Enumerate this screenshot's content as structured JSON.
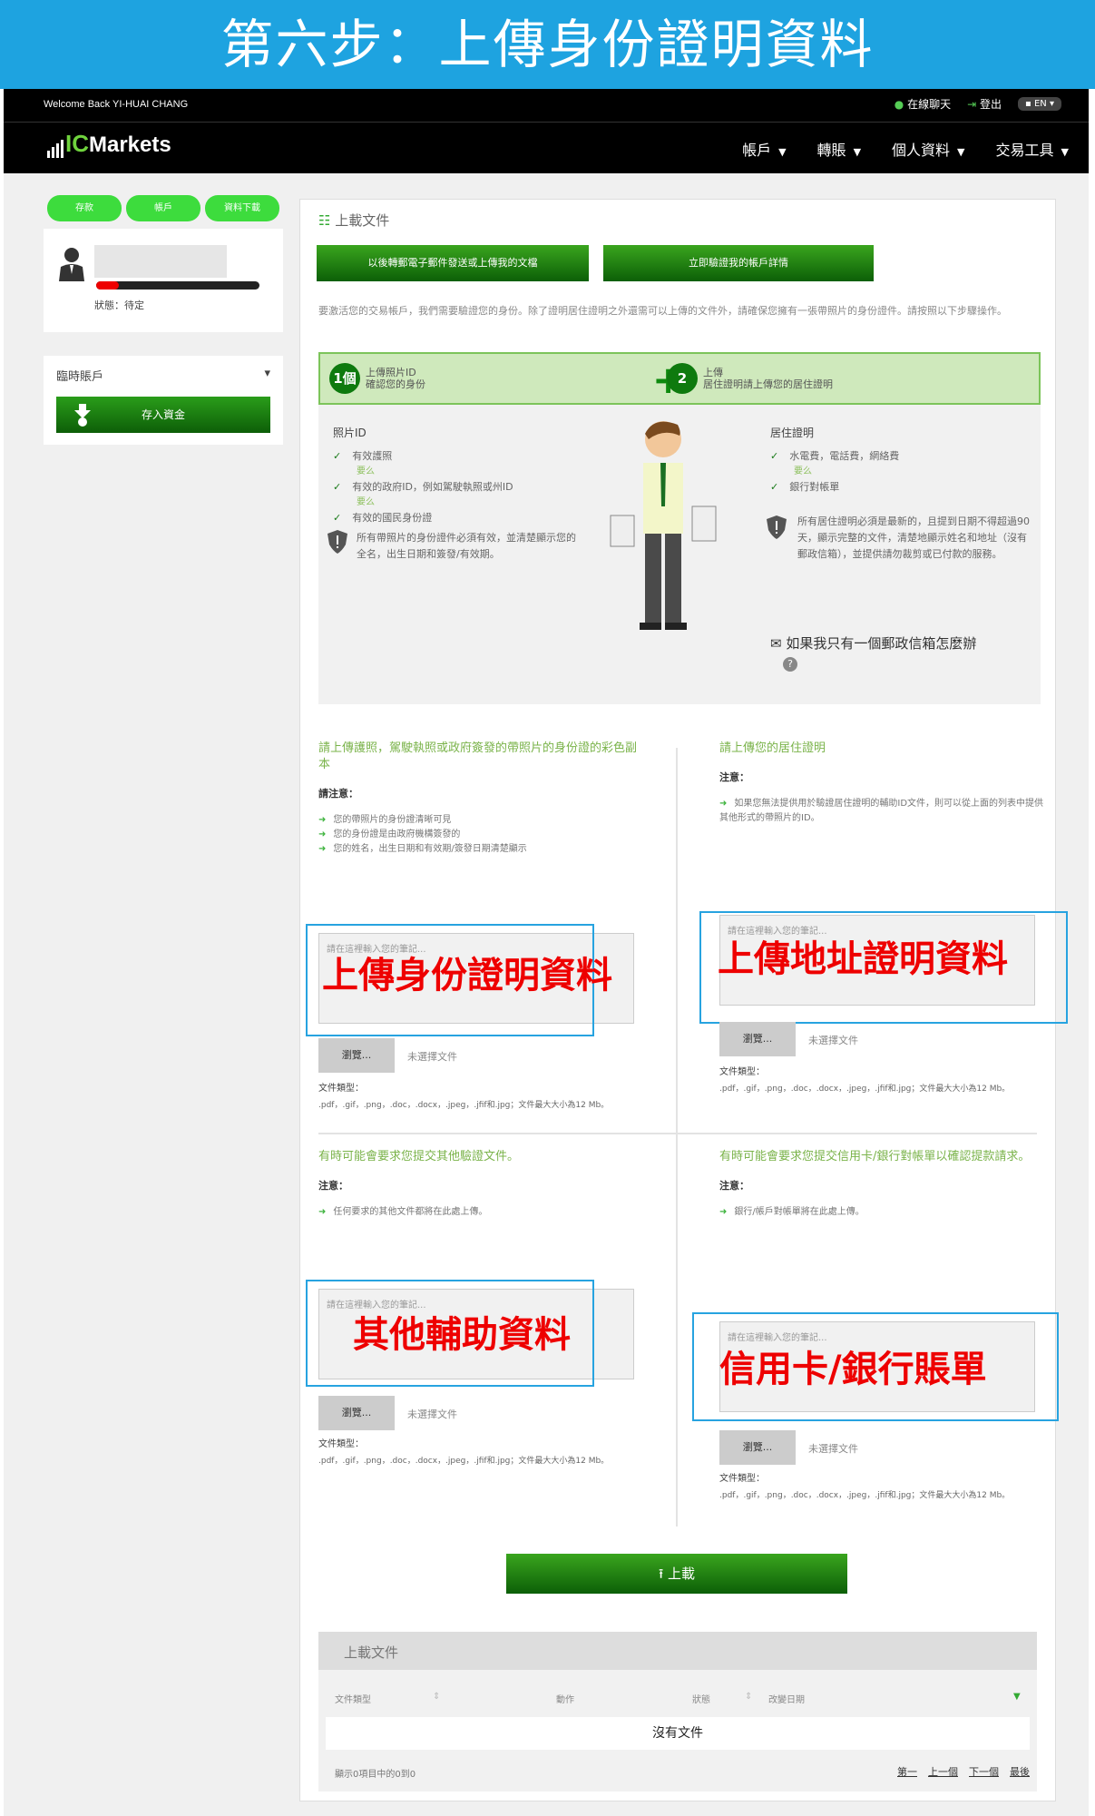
{
  "banner": {
    "title": "第六步：上傳身份證明資料"
  },
  "topbar": {
    "welcome": "Welcome Back YI-HUAI CHANG",
    "chat": "在線聊天",
    "logout": "登出",
    "lang": "EN"
  },
  "nav": {
    "logo": "Markets",
    "logo_ic": "IC",
    "items": [
      "帳戶",
      "轉賬",
      "個人資料",
      "交易工具"
    ]
  },
  "sidebar": {
    "pills": [
      "存款",
      "帳戶",
      "資料下載"
    ],
    "status": "狀態：待定",
    "progress": 0.14,
    "account_label": "臨時賬戶",
    "deposit": "存入資金"
  },
  "main": {
    "title": "上載文件",
    "btn_email": "以後轉郵電子郵件發送或上傳我的文檔",
    "btn_verify": "立即驗證我的帳戶詳情",
    "intro": "要激活您的交易帳戶，我們需要驗證您的身份。除了證明居住證明之外還需可以上傳的文件外，請確保您擁有一張帶照片的身份證件。請按照以下步驟操作。",
    "step1_num": "1個",
    "step1_t1": "上傳照片ID",
    "step1_t2": "確認您的身份",
    "step2_num": "2",
    "step2_t1": "上傳",
    "step2_t2": "居住證明請上傳您的居住證明",
    "left_head": "照片ID",
    "left_items": [
      "有效護照",
      "有效的政府ID，例如駕駛執照或州ID",
      "有效的國民身份證"
    ],
    "or": "要么",
    "left_note": "所有帶照片的身份證件必須有效，並清楚顯示您的全名，出生日期和簽發/有效期。",
    "right_head": "居住證明",
    "right_items": [
      "水電費，電話費，網絡費",
      "銀行對帳單"
    ],
    "right_note": "所有居住證明必須是最新的，且提到日期不得超過90天，顯示完整的文件，清楚地顯示姓名和地址（沒有郵政信箱），並提供請勿裁剪或已付款的服務。",
    "mail_q": "如果我只有一個郵政信箱怎麼辦"
  },
  "sections": [
    {
      "title": "請上傳護照，駕駛執照或政府簽發的帶照片的身份證的彩色副本",
      "note": "請注意：",
      "items": [
        "您的帶照片的身份證清晰可見",
        "您的身份證是由政府機構簽發的",
        "您的姓名，出生日期和有效期/簽發日期清楚顯示"
      ],
      "placeholder": "請在這裡輸入您的筆記...",
      "overlay": "上傳身份證明資料",
      "browse": "瀏覽...",
      "nofile": "未選擇文件",
      "ftype_label": "文件類型：",
      "ftype": ".pdf，.gif，.png，.doc，.docx，.jpeg，.jfif和.jpg；文件最大大小為12 Mb。"
    },
    {
      "title": "請上傳您的居住證明",
      "note": "注意：",
      "items": [
        "如果您無法提供用於驗證居住證明的輔助ID文件，則可以從上面的列表中提供其他形式的帶照片的ID。"
      ],
      "placeholder": "請在這裡輸入您的筆記...",
      "overlay": "上傳地址證明資料",
      "browse": "瀏覽...",
      "nofile": "未選擇文件",
      "ftype_label": "文件類型：",
      "ftype": ".pdf，.gif，.png，.doc，.docx，.jpeg，.jfif和.jpg；文件最大大小為12 Mb。"
    },
    {
      "title": "有時可能會要求您提交其他驗證文件。",
      "note": "注意：",
      "items": [
        "任何要求的其他文件都將在此處上傳。"
      ],
      "placeholder": "請在這裡輸入您的筆記...",
      "overlay": "其他輔助資料",
      "browse": "瀏覽...",
      "nofile": "未選擇文件",
      "ftype_label": "文件類型：",
      "ftype": ".pdf，.gif，.png，.doc，.docx，.jpeg，.jfif和.jpg；文件最大大小為12 Mb。"
    },
    {
      "title": "有時可能會要求您提交信用卡/銀行對帳單以確認提款請求。",
      "note": "注意：",
      "items": [
        "銀行/帳戶對帳單將在此處上傳。"
      ],
      "placeholder": "請在這裡輸入您的筆記...",
      "overlay": "信用卡/銀行賬單",
      "browse": "瀏覽...",
      "nofile": "未選擇文件",
      "ftype_label": "文件類型：",
      "ftype": ".pdf，.gif，.png，.doc，.docx，.jpeg，.jfif和.jpg；文件最大大小為12 Mb。"
    }
  ],
  "upload": {
    "label": "上載"
  },
  "table": {
    "title": "上載文件",
    "cols": [
      "文件類型",
      "動作",
      "狀態",
      "改變日期"
    ],
    "empty": "沒有文件",
    "info": "顯示0項目中的0到0",
    "pager": [
      "第一",
      "上一個",
      "下一個",
      "最後"
    ]
  }
}
